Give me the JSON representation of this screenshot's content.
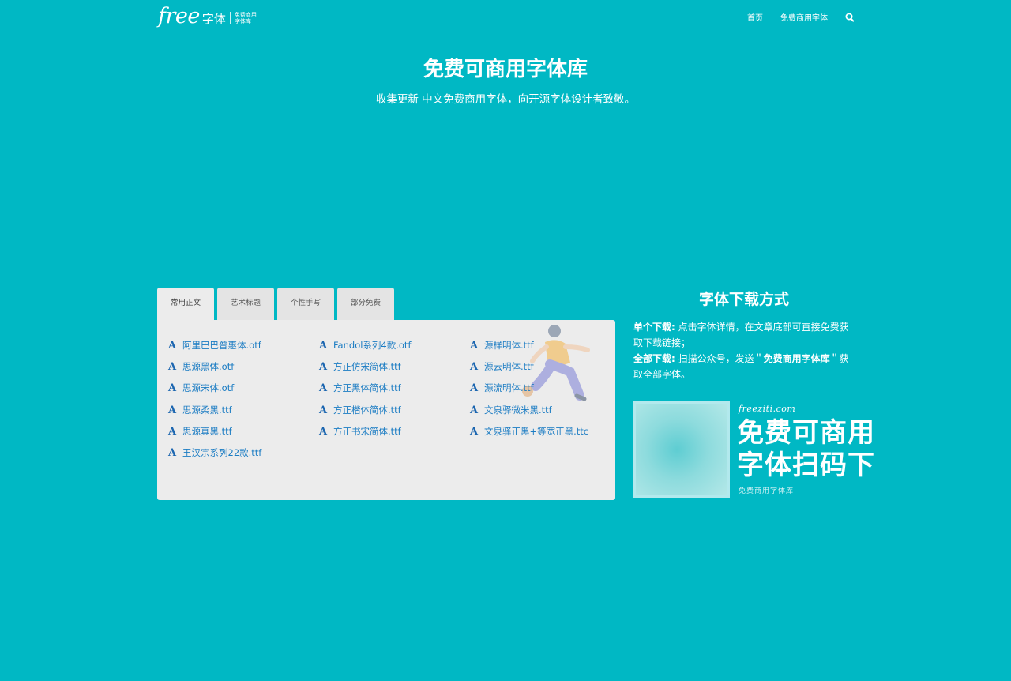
{
  "header": {
    "logo_free": "free",
    "logo_ziti": "字体",
    "logo_sub_1": "免费商用",
    "logo_sub_2": "字体库",
    "nav": [
      "首页",
      "免费商用字体"
    ]
  },
  "hero": {
    "title": "免费可商用字体库",
    "subtitle": "收集更新 中文免费商用字体，向开源字体设计者致敬。"
  },
  "tabs": [
    "常用正文",
    "艺术标题",
    "个性手写",
    "部分免费"
  ],
  "font_icon": "A",
  "fonts": [
    [
      "阿里巴巴普惠体.otf",
      "思源黑体.otf",
      "思源宋体.otf",
      "思源柔黑.ttf",
      "思源真黑.ttf",
      "王汉宗系列22款.ttf"
    ],
    [
      "Fandol系列4款.otf",
      "方正仿宋简体.ttf",
      "方正黑体简体.ttf",
      "方正楷体简体.ttf",
      "方正书宋简体.ttf"
    ],
    [
      "源样明体.ttf",
      "源云明体.ttf",
      "源流明体.ttf",
      "文泉驿微米黑.ttf",
      "文泉驿正黑+等宽正黑.ttc"
    ]
  ],
  "download": {
    "title": "字体下载方式",
    "single_label": "单个下载:",
    "single_text": " 点击字体详情，在文章底部可直接免费获取下载链接；",
    "all_label": "全部下载:",
    "all_text_1": " 扫描公众号，发送＂",
    "all_keyword": "免费商用字体库",
    "all_text_2": "＂获取全部字体。"
  },
  "promo": {
    "url": "freeziti.com",
    "line1": "免费可商用",
    "line2": "字体扫码下",
    "foot": "免费商用字体库"
  },
  "colors": {
    "background": "#00b8c4",
    "panel": "#ececec",
    "link": "#1b7cc3"
  }
}
